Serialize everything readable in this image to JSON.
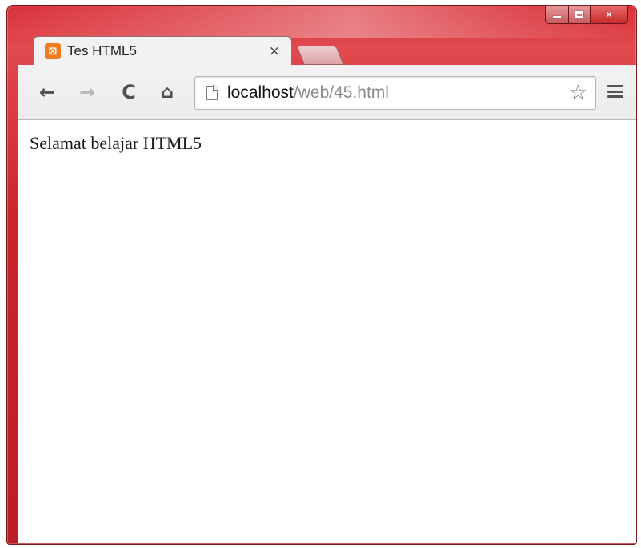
{
  "window": {
    "controls": {
      "minimize": "minimize",
      "maximize": "maximize",
      "close": "×"
    }
  },
  "tab": {
    "title": "Tes HTML5",
    "favicon": "xampp-icon",
    "close_label": "×"
  },
  "toolbar": {
    "back_icon": "←",
    "forward_icon": "→",
    "reload_icon": "C",
    "home_icon": "⌂",
    "url_host": "localhost",
    "url_path": "/web/45.html",
    "star_icon": "☆"
  },
  "page": {
    "body_text": "Selamat belajar HTML5"
  },
  "colors": {
    "frame": "#c9252d",
    "tab_background": "#f2f2f2",
    "favicon": "#f07b22"
  }
}
